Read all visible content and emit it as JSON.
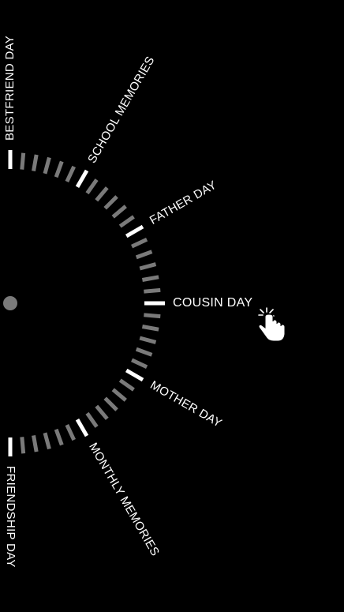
{
  "menu": {
    "items": [
      {
        "label": "BESTFRIEND DAY",
        "angle": -90,
        "selected": false
      },
      {
        "label": "SCHOOL MEMORIES",
        "angle": -60,
        "selected": false
      },
      {
        "label": "FATHER DAY",
        "angle": -30,
        "selected": false
      },
      {
        "label": "COUSIN DAY",
        "angle": 0,
        "selected": true
      },
      {
        "label": "MOTHER DAY",
        "angle": 30,
        "selected": false
      },
      {
        "label": "MONTHLY MEMORIES",
        "angle": 60,
        "selected": false
      },
      {
        "label": "FRIENDSHIP DAY",
        "angle": 90,
        "selected": false
      }
    ]
  },
  "colors": {
    "background": "#000000",
    "label": "#ffffff",
    "major_tick": "#ffffff",
    "minor_tick": "#7a7a7a",
    "center_dot": "#7a7a7a",
    "cursor": "#ffffff"
  },
  "icons": {
    "cursor": "pointer-hand-click-icon"
  }
}
